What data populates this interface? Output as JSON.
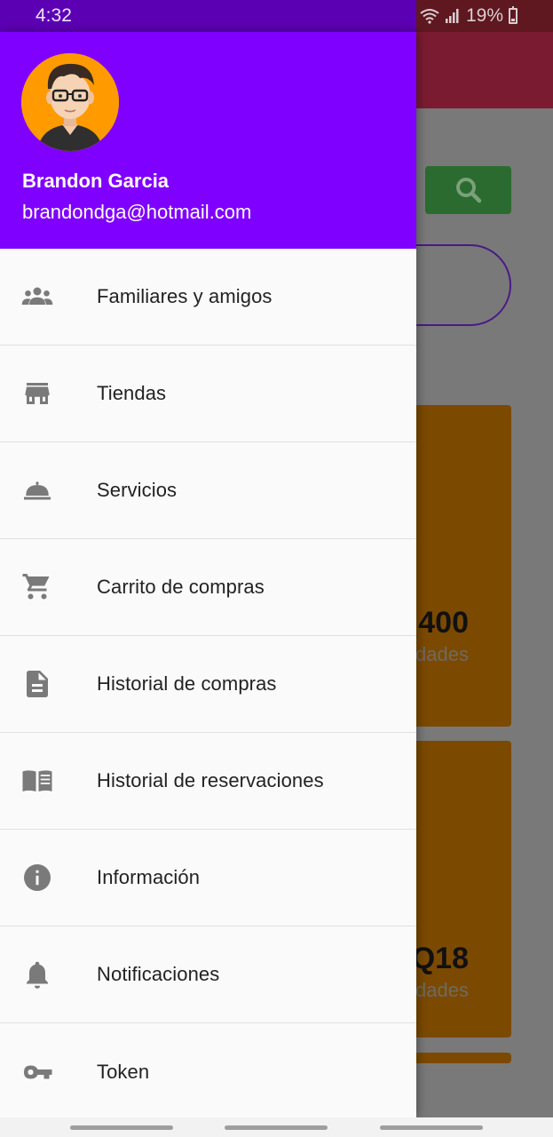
{
  "status_bar": {
    "time": "4:32",
    "battery": "19%"
  },
  "background_app": {
    "card1": {
      "price": "400",
      "units": "dades"
    },
    "card2": {
      "price": "Q18",
      "units": "dades"
    }
  },
  "drawer": {
    "user_name": "Brandon Garcia",
    "user_email": "brandondga@hotmail.com",
    "header_color": "#8000ff",
    "avatar_bg": "#ff9a00",
    "items": [
      {
        "label": "Familiares y amigos",
        "icon": "people-icon"
      },
      {
        "label": "Tiendas",
        "icon": "store-icon"
      },
      {
        "label": "Servicios",
        "icon": "room-service-icon"
      },
      {
        "label": "Carrito de compras",
        "icon": "cart-icon"
      },
      {
        "label": "Historial de compras",
        "icon": "document-icon"
      },
      {
        "label": "Historial de reservaciones",
        "icon": "book-icon"
      },
      {
        "label": "Información",
        "icon": "info-icon"
      },
      {
        "label": "Notificaciones",
        "icon": "bell-icon"
      },
      {
        "label": "Token",
        "icon": "key-icon"
      }
    ]
  }
}
